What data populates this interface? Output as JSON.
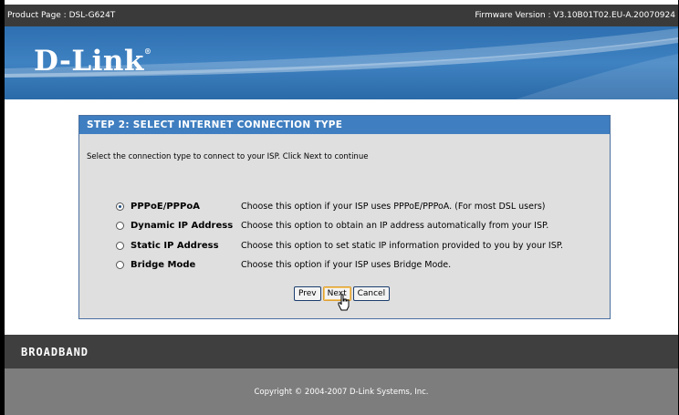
{
  "topbar": {
    "product": "Product Page : DSL-G624T",
    "firmware": "Firmware Version : V3.10B01T02.EU-A.20070924"
  },
  "brand": {
    "logo": "D-Link",
    "reg_mark": "®"
  },
  "wizard": {
    "title": "STEP 2: SELECT INTERNET CONNECTION TYPE",
    "description": "Select the connection type to connect to your ISP. Click Next to continue",
    "selected": "PPPoE/PPPoA",
    "options": [
      {
        "label": "PPPoE/PPPoA",
        "desc": "Choose this option if your ISP uses PPPoE/PPPoA. (For most DSL users)"
      },
      {
        "label": "Dynamic IP Address",
        "desc": "Choose this option to obtain an IP address automatically from your ISP."
      },
      {
        "label": "Static IP Address",
        "desc": "Choose this option to set static IP information provided to you by your ISP."
      },
      {
        "label": "Bridge Mode",
        "desc": "Choose this option if your ISP uses Bridge Mode."
      }
    ],
    "buttons": {
      "prev": "Prev",
      "next": "Next",
      "cancel": "Cancel"
    }
  },
  "broadband_label": "BROADBAND",
  "footer": {
    "copyright": "Copyright © 2004-2007 D-Link Systems, Inc."
  },
  "colors": {
    "banner": "#3f82c2",
    "panel_header": "#3f7ec0",
    "panel_bg": "#dfdfdf",
    "dark_bar": "#3f3f3f",
    "footer_bg": "#7d7d7d"
  }
}
